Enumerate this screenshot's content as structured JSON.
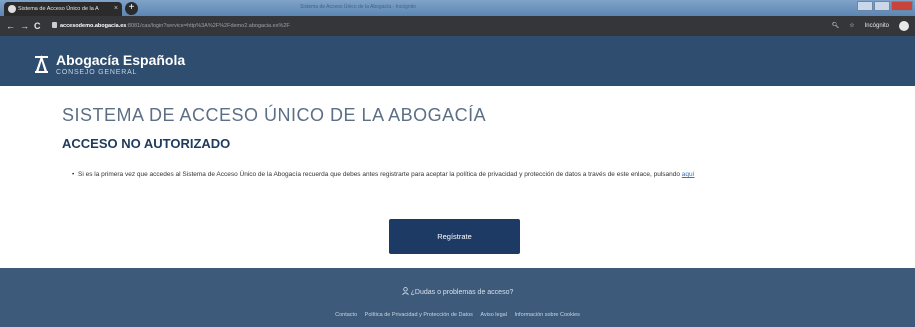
{
  "browser": {
    "tab_title": "Sistema de Acceso Único de la A",
    "tab_close": "×",
    "new_tab": "+",
    "window_title": "Sistema de Acceso Único de la Abogacía - Incógnito",
    "back": "←",
    "forward": "→",
    "reload": "C",
    "url_host": "accesodemo.abogacia.es",
    "url_path": ":8081/cas/login?service=http%3A%2F%2Fdemo2.abogacia.es%2F",
    "incognito_label": "Incógnito"
  },
  "header": {
    "brand_name": "Abogacía Española",
    "brand_sub": "CONSEJO GENERAL"
  },
  "main": {
    "title": "SISTEMA DE ACCESO ÚNICO DE LA ABOGACÍA",
    "subtitle": "ACCESO NO AUTORIZADO",
    "notice_text": "Si es la primera vez que accedes al Sistema de Acceso Único de la Abogacía recuerda que debes antes registrarte para aceptar la política de privacidad y protección de datos a través de este enlace, pulsando ",
    "notice_link": "aquí",
    "register_button": "Regístrate"
  },
  "footer": {
    "help_link": "¿Dudas o problemas de acceso?",
    "links": [
      "Contacto",
      "Política de Privacidad y Protección de Datos",
      "Aviso legal",
      "Información sobre Cookies"
    ]
  },
  "colors": {
    "header_bg": "#2f4d6e",
    "footer_bg": "#3d5a7a",
    "button_bg": "#1c3a63"
  }
}
